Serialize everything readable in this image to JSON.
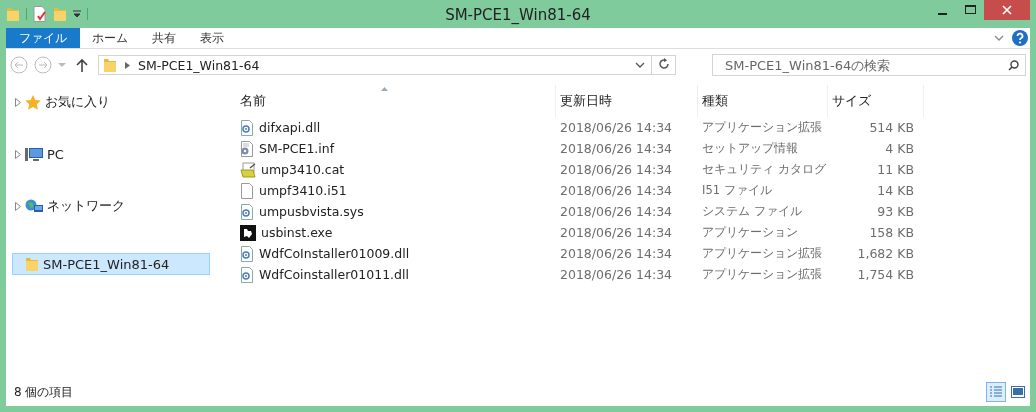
{
  "window": {
    "title": "SM-PCE1_Win81-64"
  },
  "ribbon_tabs": [
    {
      "label": "ファイル",
      "kind": "file",
      "selected": false
    },
    {
      "label": "ホーム",
      "kind": "tab",
      "selected": false
    },
    {
      "label": "共有",
      "kind": "tab",
      "selected": false
    },
    {
      "label": "表示",
      "kind": "tab",
      "selected": false
    }
  ],
  "address_bar": {
    "path": "SM-PCE1_Win81-64"
  },
  "search": {
    "placeholder": "SM-PCE1_Win81-64の検索"
  },
  "sidebar": {
    "items": [
      {
        "label": "お気に入り",
        "kind": "favorites",
        "expanded": false,
        "selected": false
      },
      {
        "label": "PC",
        "kind": "pc",
        "expanded": false,
        "selected": false
      },
      {
        "label": "ネットワーク",
        "kind": "network",
        "expanded": false,
        "selected": false
      },
      {
        "label": "SM-PCE1_Win81-64",
        "kind": "folder",
        "selected": true
      }
    ]
  },
  "table": {
    "columns": [
      {
        "label": "名前",
        "sorted": true
      },
      {
        "label": "更新日時",
        "sorted": false
      },
      {
        "label": "種類",
        "sorted": false
      },
      {
        "label": "サイズ",
        "sorted": false
      }
    ],
    "rows": [
      {
        "kind": "dll",
        "name": "difxapi.dll",
        "date": "2018/06/26 14:34",
        "type": "アプリケーション拡張",
        "size": "514 KB"
      },
      {
        "kind": "inf",
        "name": "SM-PCE1.inf",
        "date": "2018/06/26 14:34",
        "type": "セットアップ情報",
        "size": "4 KB"
      },
      {
        "kind": "cat",
        "name": "ump3410.cat",
        "date": "2018/06/26 14:34",
        "type": "セキュリティ カタログ",
        "size": "11 KB"
      },
      {
        "kind": "file",
        "name": "umpf3410.i51",
        "date": "2018/06/26 14:34",
        "type": "I51 ファイル",
        "size": "14 KB"
      },
      {
        "kind": "dll",
        "name": "umpusbvista.sys",
        "date": "2018/06/26 14:34",
        "type": "システム ファイル",
        "size": "93 KB"
      },
      {
        "kind": "exe",
        "name": "usbinst.exe",
        "date": "2018/06/26 14:34",
        "type": "アプリケーション",
        "size": "158 KB"
      },
      {
        "kind": "dll",
        "name": "WdfCoInstaller01009.dll",
        "date": "2018/06/26 14:34",
        "type": "アプリケーション拡張",
        "size": "1,682 KB"
      },
      {
        "kind": "dll",
        "name": "WdfCoinstaller01011.dll",
        "date": "2018/06/26 14:34",
        "type": "アプリケーション拡張",
        "size": "1,754 KB"
      }
    ]
  },
  "status_bar": {
    "text": "8 個の項目",
    "views": [
      {
        "kind": "details",
        "selected": true
      },
      {
        "kind": "tiles",
        "selected": false
      }
    ]
  }
}
